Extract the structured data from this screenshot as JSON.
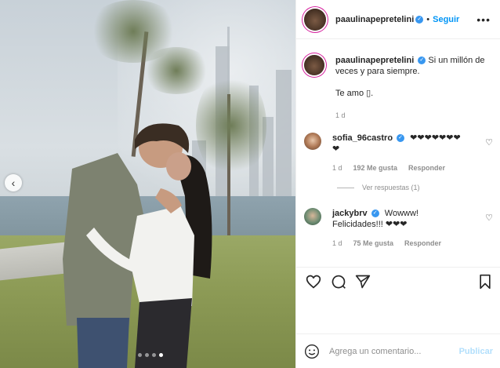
{
  "post": {
    "author": "paaulinapepretelini",
    "follow_label": "Seguir",
    "separator": "•",
    "more_icon": "more-horizontal-icon",
    "caption_line1": "Si un millón de",
    "caption_line2": "veces y para siempre.",
    "caption_line3": "Te amo ▯.",
    "caption_age": "1 d",
    "image_dots": 4,
    "active_dot": 4
  },
  "comments": [
    {
      "user": "sofia_96castro",
      "text_line1": "❤❤❤❤❤❤❤",
      "text_line2": "❤",
      "age": "1 d",
      "likes": "192 Me gusta",
      "reply": "Responder",
      "view_replies": "Ver respuestas (1)"
    },
    {
      "user": "jackybrv",
      "text_line1": "Wowww!",
      "text_line2": "Felicidades!!! ❤❤❤",
      "age": "1 d",
      "likes": "75 Me gusta",
      "reply": "Responder"
    }
  ],
  "actions": {
    "icons": [
      "heart-icon",
      "comment-icon",
      "share-icon",
      "bookmark-icon"
    ]
  },
  "compose": {
    "placeholder": "Agrega un comentario...",
    "publish": "Publicar",
    "emoji_icon": "emoji-icon"
  },
  "colors": {
    "link_blue": "#0095f6",
    "verified_blue": "#3897f0",
    "muted_text": "#8e8e8e",
    "publish_disabled": "#b2dffc",
    "border": "#efefef"
  }
}
